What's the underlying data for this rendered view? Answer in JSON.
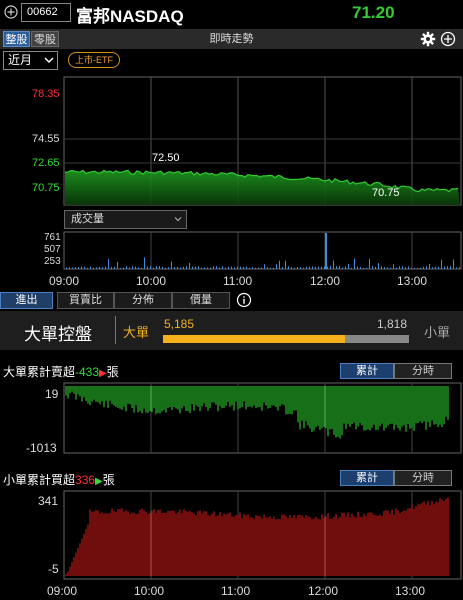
{
  "header": {
    "stock_code": "00662",
    "title": "富邦NASDAQ",
    "price": "71.20"
  },
  "mode_tabs": [
    {
      "label": "整股"
    },
    {
      "label": "零股"
    }
  ],
  "chart_title": "即時走勢",
  "period": {
    "selected": "近月"
  },
  "badge": "上市-ETF",
  "price_chart": {
    "y_ticks": [
      "78.35",
      "74.55",
      "72.65",
      "70.75"
    ],
    "annotations": {
      "high": "72.50",
      "low": "70.75"
    }
  },
  "volume": {
    "selector": "成交量",
    "y_ticks": [
      "761",
      "507",
      "253"
    ]
  },
  "time_axis": [
    "09:00",
    "10:00",
    "11:00",
    "12:00",
    "13:00"
  ],
  "bottom_tabs": [
    {
      "label": "進出"
    },
    {
      "label": "買賣比"
    },
    {
      "label": "分佈"
    },
    {
      "label": "價量"
    }
  ],
  "big_order": {
    "title": "大單控盤",
    "big_label": "大單",
    "big_value": "5,185",
    "small_value": "1,818",
    "small_label": "小單",
    "big_ratio": 0.7404
  },
  "big_cumulative": {
    "label_prefix": "大單累計賣超",
    "value": "-433",
    "unit": "張",
    "y_ticks": [
      "19",
      "-1013"
    ],
    "toggle": [
      "累計",
      "分時"
    ]
  },
  "small_cumulative": {
    "label_prefix": "小單累計買超",
    "value": "336",
    "unit": "張",
    "y_ticks": [
      "341",
      "-5"
    ],
    "toggle": [
      "累計",
      "分時"
    ]
  },
  "colors": {
    "up": "#ff3030",
    "down": "#33dd33",
    "accent": "#f0b020",
    "price_line": "#1fa31f"
  }
}
